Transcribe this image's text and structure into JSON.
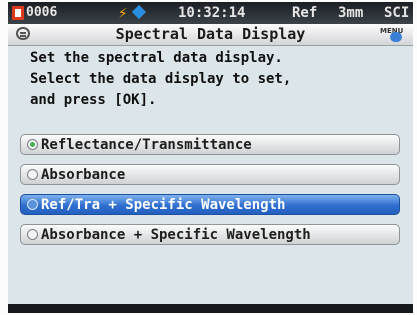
{
  "status_bar": {
    "sample_id": "0006",
    "time": "10:32:14",
    "mode": "Ref",
    "aperture": "3mm",
    "specular": "SCI",
    "icons": [
      "memo-icon",
      "battery-bolt-icon",
      "bluetooth-diamond-icon"
    ],
    "accent_colors": {
      "memo": "#e03a1e",
      "bolt": "#f5a20a",
      "diamond": "#2a8fe0"
    }
  },
  "title_bar": {
    "title": "Spectral Data Display",
    "left_icon": "document-icon",
    "menu_label": "MENU"
  },
  "instructions": [
    "Set the spectral data display.",
    "Select the data display to set,",
    "and press [OK]."
  ],
  "options": [
    {
      "label": "Reflectance/Transmittance",
      "checked": true,
      "highlighted": false
    },
    {
      "label": "Absorbance",
      "checked": false,
      "highlighted": false
    },
    {
      "label": "Ref/Tra + Specific Wavelength",
      "checked": false,
      "highlighted": true
    },
    {
      "label": "Absorbance + Specific Wavelength",
      "checked": false,
      "highlighted": false
    }
  ],
  "colors": {
    "background": "#dce6ea",
    "highlight": "#2f6fd0",
    "radio_checked": "#46b04a"
  }
}
